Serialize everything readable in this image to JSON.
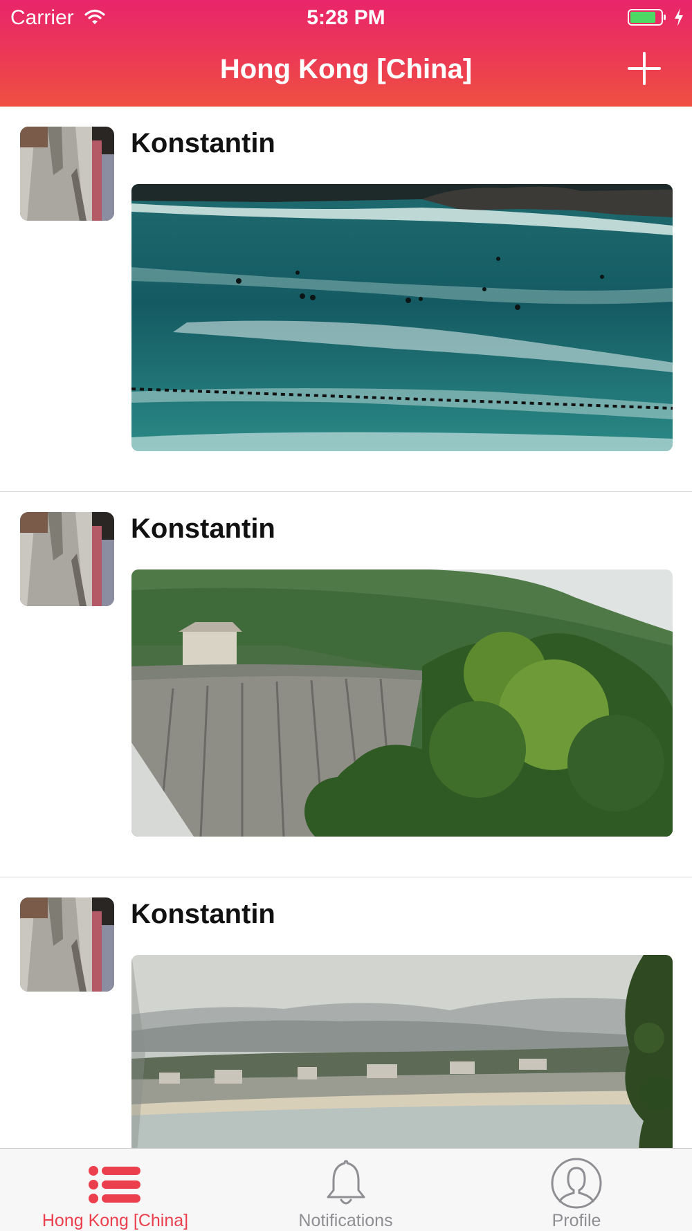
{
  "status_bar": {
    "carrier": "Carrier",
    "time": "5:28 PM",
    "wifi_icon": "wifi-icon",
    "battery_icon": "battery-charging-icon"
  },
  "nav": {
    "title": "Hong Kong [China]",
    "add_icon": "plus-icon"
  },
  "feed": {
    "posts": [
      {
        "author": "Konstantin",
        "photo": "sea-with-swimmers"
      },
      {
        "author": "Konstantin",
        "photo": "dam-and-forested-hills"
      },
      {
        "author": "Konstantin",
        "photo": "hazy-bay-with-town"
      }
    ]
  },
  "tabbar": {
    "items": [
      {
        "label": "Hong Kong [China]",
        "icon": "list-icon",
        "active": true
      },
      {
        "label": "Notifications",
        "icon": "bell-icon",
        "active": false
      },
      {
        "label": "Profile",
        "icon": "person-icon",
        "active": false
      }
    ]
  },
  "colors": {
    "accent": "#ec3f4d",
    "header_top": "#e8256a",
    "header_bottom": "#ef5040",
    "tab_inactive": "#8e8e93"
  }
}
